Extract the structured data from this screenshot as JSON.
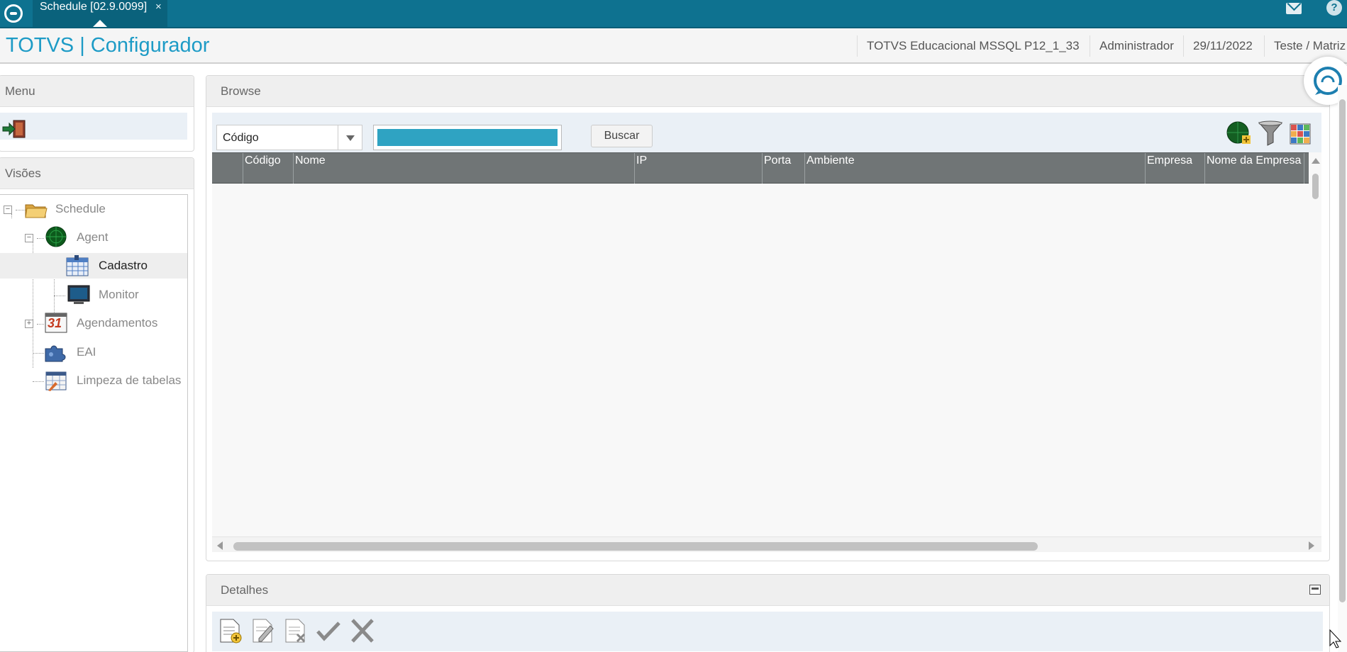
{
  "topbar": {
    "tab_label": "Schedule [02.9.0099]",
    "tab_close": "×",
    "icons": [
      "totvs-logo-icon",
      "mail-icon",
      "help-icon"
    ],
    "help_glyph": "?"
  },
  "header": {
    "title": "TOTVS | Configurador",
    "environment": "TOTVS Educacional MSSQL P12_1_33",
    "user": "Administrador",
    "date": "29/11/2022",
    "company": "Teste / Matriz"
  },
  "menu_panel": {
    "title": "Menu"
  },
  "visoes_panel": {
    "title": "Visões",
    "tree": [
      {
        "label": "Schedule",
        "icon": "folder-icon",
        "toggle": "−"
      },
      {
        "label": "Agent",
        "icon": "radar-globe-icon",
        "toggle": "−"
      },
      {
        "label": "Cadastro",
        "icon": "calendar-grid-icon",
        "selected": true
      },
      {
        "label": "Monitor",
        "icon": "monitor-icon"
      },
      {
        "label": "Agendamentos",
        "icon": "calendar-31-icon",
        "toggle": "+",
        "calendar_number": "31"
      },
      {
        "label": "EAI",
        "icon": "puzzle-icon"
      },
      {
        "label": "Limpeza de tabelas",
        "icon": "table-clean-icon"
      }
    ]
  },
  "browse": {
    "title": "Browse",
    "search_field_value": "Código",
    "search_input_value": "",
    "search_button": "Buscar",
    "toolbar_icons": [
      "add-record-icon",
      "filter-icon",
      "grid-config-icon"
    ],
    "columns": [
      "Código",
      "Nome",
      "IP",
      "Porta",
      "Ambiente",
      "Empresa",
      "Nome da Empresa"
    ],
    "rows": []
  },
  "detalhes": {
    "title": "Detalhes",
    "toolbar_icons": [
      "new-document-icon",
      "edit-document-icon",
      "delete-document-icon",
      "confirm-check-icon",
      "cancel-x-icon"
    ]
  },
  "colors": {
    "topbar": "#0e7290",
    "title_text": "#1d9bc6",
    "grid_header": "#707576",
    "search_input_fill": "#2fa3c2"
  }
}
